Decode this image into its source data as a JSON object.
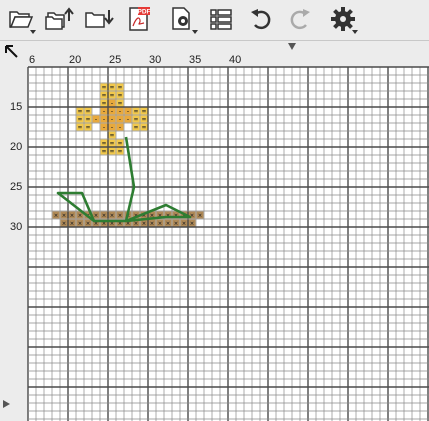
{
  "toolbar": {
    "buttons": [
      {
        "name": "open-folder-button",
        "icon": "folder-open-icon"
      },
      {
        "name": "open-multiple-button",
        "icon": "folders-upload-icon"
      },
      {
        "name": "import-folder-button",
        "icon": "folder-download-icon"
      },
      {
        "name": "export-pdf-button",
        "icon": "pdf-icon",
        "label": "PDF"
      },
      {
        "name": "page-settings-button",
        "icon": "page-gear-icon"
      },
      {
        "name": "list-view-button",
        "icon": "list-icon"
      },
      {
        "name": "undo-button",
        "icon": "undo-icon"
      },
      {
        "name": "redo-button",
        "icon": "redo-icon"
      },
      {
        "name": "settings-button",
        "icon": "gear-icon"
      }
    ],
    "pdf_label": "PDF"
  },
  "rulers": {
    "unsaved_marker": "*",
    "top_labels": [
      "6",
      "20",
      "25",
      "30",
      "35",
      "40"
    ],
    "left_labels": [
      "15",
      "20",
      "25",
      "30"
    ]
  },
  "chart_data": {
    "type": "cross-stitch-chart",
    "first_column": 15,
    "first_row": 10,
    "columns_visible": 25,
    "rows_visible": 22,
    "colors": {
      "grid_line": "#8a8a8a",
      "grid_major": "#4a4a4a",
      "background": "#ffffff",
      "yellow": "#f2c94c",
      "orange": "#e8a93c",
      "brown": "#b08a57",
      "stem": "#2e7d32"
    },
    "symbols": {
      "yellow": "=",
      "orange": "-",
      "brown": "×",
      "stem_mid": "="
    },
    "yellow_cells": [
      [
        24,
        12
      ],
      [
        25,
        12
      ],
      [
        26,
        12
      ],
      [
        24,
        13
      ],
      [
        25,
        13
      ],
      [
        26,
        13
      ],
      [
        24,
        14
      ],
      [
        26,
        14
      ],
      [
        21,
        15
      ],
      [
        22,
        15
      ],
      [
        28,
        15
      ],
      [
        29,
        15
      ],
      [
        21,
        16
      ],
      [
        22,
        16
      ],
      [
        28,
        16
      ],
      [
        29,
        16
      ],
      [
        21,
        17
      ],
      [
        22,
        17
      ],
      [
        28,
        17
      ],
      [
        29,
        17
      ],
      [
        25,
        18
      ],
      [
        24,
        19
      ],
      [
        25,
        19
      ],
      [
        26,
        19
      ],
      [
        24,
        20
      ],
      [
        25,
        20
      ],
      [
        26,
        20
      ]
    ],
    "orange_cells": [
      [
        25,
        14
      ],
      [
        24,
        15
      ],
      [
        25,
        15
      ],
      [
        26,
        15
      ],
      [
        27,
        15
      ],
      [
        23,
        16
      ],
      [
        24,
        16
      ],
      [
        25,
        16
      ],
      [
        26,
        16
      ],
      [
        27,
        16
      ],
      [
        24,
        17
      ],
      [
        25,
        17
      ],
      [
        26,
        17
      ]
    ],
    "brown_cells_row1": {
      "row": 28,
      "from": 18,
      "to": 36
    },
    "brown_cells_row2": {
      "row": 29,
      "from": 19,
      "to": 35
    },
    "stem_lines": [
      [
        [
          27.25,
          18.75
        ],
        [
          28.25,
          25.0
        ],
        [
          27.25,
          29.25
        ]
      ],
      [
        [
          27.25,
          29.25
        ],
        [
          23.25,
          29.25
        ],
        [
          18.75,
          25.75
        ],
        [
          21.75,
          25.75
        ],
        [
          23.25,
          29.25
        ]
      ],
      [
        [
          27.25,
          29.25
        ],
        [
          32.25,
          28.75
        ],
        [
          35.25,
          28.75
        ],
        [
          32.25,
          27.25
        ],
        [
          27.25,
          29.25
        ]
      ]
    ]
  }
}
